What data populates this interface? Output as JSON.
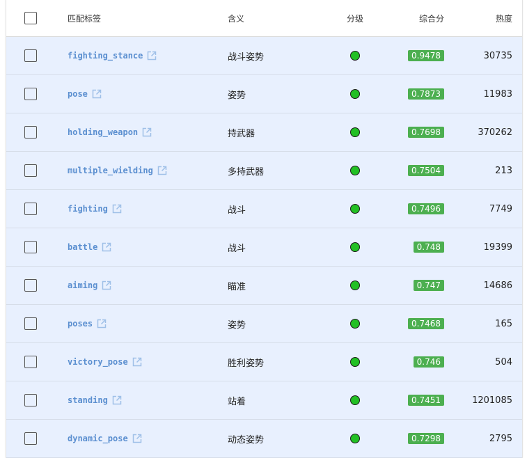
{
  "header": {
    "tag": "匹配标签",
    "meaning": "含义",
    "grade": "分级",
    "score": "综合分",
    "heat": "热度"
  },
  "colors": {
    "row_bg": "#e8f0fe",
    "tag_link": "#5b8fd0",
    "grade_dot": "#22c024",
    "score_badge": "#4caf50"
  },
  "rows": [
    {
      "tag": "fighting_stance",
      "meaning": "战斗姿势",
      "grade_icon": "green-circle-icon",
      "score": "0.9478",
      "heat": "30735"
    },
    {
      "tag": "pose",
      "meaning": "姿势",
      "grade_icon": "green-circle-icon",
      "score": "0.7873",
      "heat": "11983"
    },
    {
      "tag": "holding_weapon",
      "meaning": "持武器",
      "grade_icon": "green-circle-icon",
      "score": "0.7698",
      "heat": "370262"
    },
    {
      "tag": "multiple_wielding",
      "meaning": "多持武器",
      "grade_icon": "green-circle-icon",
      "score": "0.7504",
      "heat": "213"
    },
    {
      "tag": "fighting",
      "meaning": "战斗",
      "grade_icon": "green-circle-icon",
      "score": "0.7496",
      "heat": "7749"
    },
    {
      "tag": "battle",
      "meaning": "战斗",
      "grade_icon": "green-circle-icon",
      "score": "0.748",
      "heat": "19399"
    },
    {
      "tag": "aiming",
      "meaning": "瞄准",
      "grade_icon": "green-circle-icon",
      "score": "0.747",
      "heat": "14686"
    },
    {
      "tag": "poses",
      "meaning": "姿势",
      "grade_icon": "green-circle-icon",
      "score": "0.7468",
      "heat": "165"
    },
    {
      "tag": "victory_pose",
      "meaning": "胜利姿势",
      "grade_icon": "green-circle-icon",
      "score": "0.746",
      "heat": "504"
    },
    {
      "tag": "standing",
      "meaning": "站着",
      "grade_icon": "green-circle-icon",
      "score": "0.7451",
      "heat": "1201085"
    },
    {
      "tag": "dynamic_pose",
      "meaning": "动态姿势",
      "grade_icon": "green-circle-icon",
      "score": "0.7298",
      "heat": "2795"
    }
  ]
}
